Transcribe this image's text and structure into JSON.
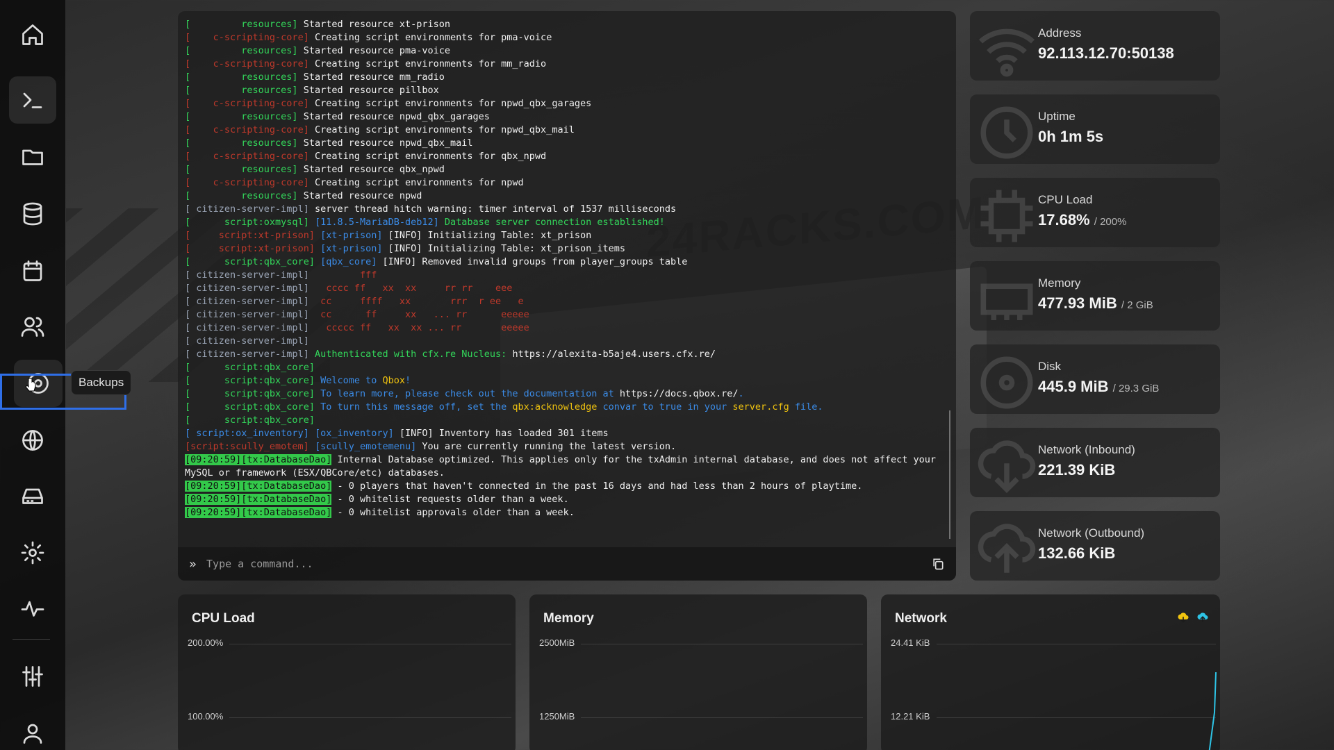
{
  "sidebar": {
    "items": [
      {
        "name": "home",
        "icon": "home-icon"
      },
      {
        "name": "console",
        "icon": "terminal-icon",
        "active": true
      },
      {
        "name": "files",
        "icon": "folder-icon"
      },
      {
        "name": "databases",
        "icon": "database-icon"
      },
      {
        "name": "schedules",
        "icon": "calendar-icon"
      },
      {
        "name": "users",
        "icon": "users-icon"
      },
      {
        "name": "backups",
        "icon": "backup-icon",
        "hovered": true
      },
      {
        "name": "network",
        "icon": "globe-icon"
      },
      {
        "name": "startup",
        "icon": "hard-drive-icon"
      },
      {
        "name": "settings",
        "icon": "gear-icon"
      },
      {
        "name": "activity",
        "icon": "activity-icon"
      },
      {
        "name": "admin",
        "icon": "sliders-icon"
      },
      {
        "name": "account",
        "icon": "user-icon"
      }
    ],
    "tooltip": "Backups"
  },
  "console": {
    "lines": [
      [
        [
          "[ ",
          "c-green"
        ],
        [
          "        resources] ",
          "c-green"
        ],
        [
          "Started resource xt-prison",
          "c-white"
        ]
      ],
      [
        [
          "[ ",
          "c-red"
        ],
        [
          "   c-scripting-core] ",
          "c-red"
        ],
        [
          "Creating script environments for pma-voice",
          "c-white"
        ]
      ],
      [
        [
          "[ ",
          "c-green"
        ],
        [
          "        resources] ",
          "c-green"
        ],
        [
          "Started resource pma-voice",
          "c-white"
        ]
      ],
      [
        [
          "[ ",
          "c-red"
        ],
        [
          "   c-scripting-core] ",
          "c-red"
        ],
        [
          "Creating script environments for mm_radio",
          "c-white"
        ]
      ],
      [
        [
          "[ ",
          "c-green"
        ],
        [
          "        resources] ",
          "c-green"
        ],
        [
          "Started resource mm_radio",
          "c-white"
        ]
      ],
      [
        [
          "[ ",
          "c-green"
        ],
        [
          "        resources] ",
          "c-green"
        ],
        [
          "Started resource pillbox",
          "c-white"
        ]
      ],
      [
        [
          "[ ",
          "c-red"
        ],
        [
          "   c-scripting-core] ",
          "c-red"
        ],
        [
          "Creating script environments for npwd_qbx_garages",
          "c-white"
        ]
      ],
      [
        [
          "[ ",
          "c-green"
        ],
        [
          "        resources] ",
          "c-green"
        ],
        [
          "Started resource npwd_qbx_garages",
          "c-white"
        ]
      ],
      [
        [
          "[ ",
          "c-red"
        ],
        [
          "   c-scripting-core] ",
          "c-red"
        ],
        [
          "Creating script environments for npwd_qbx_mail",
          "c-white"
        ]
      ],
      [
        [
          "[ ",
          "c-green"
        ],
        [
          "        resources] ",
          "c-green"
        ],
        [
          "Started resource npwd_qbx_mail",
          "c-white"
        ]
      ],
      [
        [
          "[ ",
          "c-red"
        ],
        [
          "   c-scripting-core] ",
          "c-red"
        ],
        [
          "Creating script environments for qbx_npwd",
          "c-white"
        ]
      ],
      [
        [
          "[ ",
          "c-green"
        ],
        [
          "        resources] ",
          "c-green"
        ],
        [
          "Started resource qbx_npwd",
          "c-white"
        ]
      ],
      [
        [
          "[ ",
          "c-red"
        ],
        [
          "   c-scripting-core] ",
          "c-red"
        ],
        [
          "Creating script environments for npwd",
          "c-white"
        ]
      ],
      [
        [
          "[ ",
          "c-green"
        ],
        [
          "        resources] ",
          "c-green"
        ],
        [
          "Started resource npwd",
          "c-white"
        ]
      ],
      [
        [
          "[ ",
          "c-gray"
        ],
        [
          "citizen-server-impl] ",
          "c-gray"
        ],
        [
          "server thread hitch warning: timer interval of 1537 milliseconds",
          "c-white"
        ]
      ],
      [
        [
          "[ ",
          "c-green"
        ],
        [
          "     script:oxmysql] ",
          "c-green"
        ],
        [
          "[11.8.5-MariaDB-deb12] ",
          "c-blue"
        ],
        [
          "Database server connection established!",
          "c-green"
        ]
      ],
      [
        [
          "[ ",
          "c-red"
        ],
        [
          "    script:xt-prison] ",
          "c-red"
        ],
        [
          "[xt-prison] ",
          "c-blue"
        ],
        [
          "[INFO] Initializing Table: xt_prison",
          "c-white"
        ]
      ],
      [
        [
          "[ ",
          "c-red"
        ],
        [
          "    script:xt-prison] ",
          "c-red"
        ],
        [
          "[xt-prison] ",
          "c-blue"
        ],
        [
          "[INFO] Initializing Table: xt_prison_items",
          "c-white"
        ]
      ],
      [
        [
          "[ ",
          "c-green"
        ],
        [
          "     script:qbx_core] ",
          "c-green"
        ],
        [
          "[qbx_core] ",
          "c-blue"
        ],
        [
          "[INFO] Removed invalid groups from player_groups table",
          "c-white"
        ]
      ],
      [
        [
          "[ ",
          "c-gray"
        ],
        [
          "citizen-server-impl] ",
          "c-gray"
        ],
        [
          "        fff",
          "c-red"
        ]
      ],
      [
        [
          "[ ",
          "c-gray"
        ],
        [
          "citizen-server-impl] ",
          "c-gray"
        ],
        [
          "  cccc ff   xx  xx     rr rr    eee",
          "c-red"
        ]
      ],
      [
        [
          "[ ",
          "c-gray"
        ],
        [
          "citizen-server-impl] ",
          "c-gray"
        ],
        [
          " cc     ffff   xx       rrr  r ee   e",
          "c-red"
        ]
      ],
      [
        [
          "[ ",
          "c-gray"
        ],
        [
          "citizen-server-impl] ",
          "c-gray"
        ],
        [
          " cc      ff     xx   ... rr      eeeee",
          "c-red"
        ]
      ],
      [
        [
          "[ ",
          "c-gray"
        ],
        [
          "citizen-server-impl] ",
          "c-gray"
        ],
        [
          "  ccccc ff   xx  xx ... rr       eeeee",
          "c-red"
        ]
      ],
      [
        [
          "[ ",
          "c-gray"
        ],
        [
          "citizen-server-impl] ",
          "c-gray"
        ]
      ],
      [
        [
          "[ ",
          "c-gray"
        ],
        [
          "citizen-server-impl] ",
          "c-gray"
        ],
        [
          "Authenticated with cfx.re Nucleus: ",
          "c-green"
        ],
        [
          "https://alexita-b5aje4.users.cfx.re/",
          "c-white"
        ]
      ],
      [
        [
          "[ ",
          "c-green"
        ],
        [
          "     script:qbx_core] ",
          "c-green"
        ]
      ],
      [
        [
          "[ ",
          "c-green"
        ],
        [
          "     script:qbx_core] ",
          "c-green"
        ],
        [
          "Welcome to ",
          "c-blue"
        ],
        [
          "Qbox",
          "c-yellow"
        ],
        [
          "!",
          "c-blue"
        ]
      ],
      [
        [
          "[ ",
          "c-green"
        ],
        [
          "     script:qbx_core] ",
          "c-green"
        ],
        [
          "To learn more, please check out the documentation at ",
          "c-blue"
        ],
        [
          "https://docs.qbox.re/",
          "c-white"
        ],
        [
          ".",
          "c-blue"
        ]
      ],
      [
        [
          "[ ",
          "c-green"
        ],
        [
          "     script:qbx_core] ",
          "c-green"
        ],
        [
          "To turn this message off, set the ",
          "c-blue"
        ],
        [
          "qbx:acknowledge",
          "c-yellow"
        ],
        [
          " convar to true in your ",
          "c-blue"
        ],
        [
          "server.cfg",
          "c-yellow"
        ],
        [
          " file.",
          "c-blue"
        ]
      ],
      [
        [
          "[ ",
          "c-green"
        ],
        [
          "     script:qbx_core] ",
          "c-green"
        ]
      ],
      [
        [
          "[ ",
          "c-blue"
        ],
        [
          "script:ox_inventory] ",
          "c-blue"
        ],
        [
          "[ox_inventory] ",
          "c-blue"
        ],
        [
          "[INFO] Inventory has loaded 301 items",
          "c-white"
        ]
      ],
      [
        [
          "[script:scully_emotem] ",
          "c-red"
        ],
        [
          "[scully_emotemenu] ",
          "c-blue"
        ],
        [
          "You are currently running the latest version.",
          "c-white"
        ]
      ],
      [
        [
          "[09:20:59][tx:DatabaseDao]",
          "hl"
        ],
        [
          " Internal Database optimized. This applies only for the txAdmin internal database, and does not affect your MySQL or framework (ESX/QBCore/etc) databases.",
          "c-white"
        ]
      ],
      [
        [
          "[09:20:59][tx:DatabaseDao]",
          "hl"
        ],
        [
          " - 0 players that haven't connected in the past 16 days and had less than 2 hours of playtime.",
          "c-white"
        ]
      ],
      [
        [
          "[09:20:59][tx:DatabaseDao]",
          "hl"
        ],
        [
          " - 0 whitelist requests older than a week.",
          "c-white"
        ]
      ],
      [
        [
          "[09:20:59][tx:DatabaseDao]",
          "hl"
        ],
        [
          " - 0 whitelist approvals older than a week.",
          "c-white"
        ]
      ]
    ],
    "command_placeholder": "Type a command..."
  },
  "stats": [
    {
      "label": "Address",
      "value": "92.113.12.70:50138",
      "sub": "",
      "icon": "wifi-icon"
    },
    {
      "label": "Uptime",
      "value": "0h 1m 5s",
      "sub": "",
      "icon": "clock-icon"
    },
    {
      "label": "CPU Load",
      "value": "17.68%",
      "sub": "/ 200%",
      "icon": "cpu-icon"
    },
    {
      "label": "Memory",
      "value": "477.93 MiB",
      "sub": "/ 2 GiB",
      "icon": "memory-icon"
    },
    {
      "label": "Disk",
      "value": "445.9 MiB",
      "sub": "/ 29.3 GiB",
      "icon": "disk-icon"
    },
    {
      "label": "Network (Inbound)",
      "value": "221.39 KiB",
      "sub": "",
      "icon": "cloud-download-icon"
    },
    {
      "label": "Network (Outbound)",
      "value": "132.66 KiB",
      "sub": "",
      "icon": "cloud-upload-icon"
    }
  ],
  "charts": {
    "cpu": {
      "title": "CPU Load",
      "ticks": [
        "200.00%",
        "100.00%"
      ]
    },
    "memory": {
      "title": "Memory",
      "ticks": [
        "2500MiB",
        "1250MiB"
      ]
    },
    "network": {
      "title": "Network",
      "ticks": [
        "24.41 KiB",
        "12.21 KiB"
      ],
      "inbound_color": "#f1c40f",
      "outbound_color": "#2ec4e6"
    }
  },
  "colors": {
    "accent": "#2f6fe8",
    "log_green": "#33d65a",
    "log_red": "#c0392b",
    "log_blue": "#3b8ce8"
  }
}
